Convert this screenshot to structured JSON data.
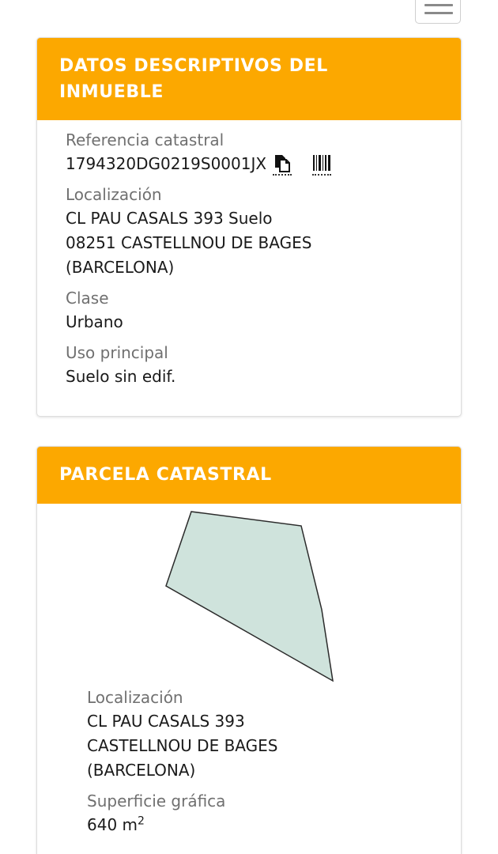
{
  "menu": {
    "icon": "hamburger-menu-icon"
  },
  "inmueble": {
    "title": "DATOS DESCRIPTIVOS DEL INMUEBLE",
    "ref_label": "Referencia catastral",
    "ref_value": "1794320DG0219S0001JX",
    "copy_icon": "copy-icon",
    "barcode_icon": "barcode-icon",
    "loc_label": "Localización",
    "loc_line1": "CL PAU CASALS 393 Suelo",
    "loc_line2": "08251 CASTELLNOU DE BAGES",
    "loc_line3": "(BARCELONA)",
    "clase_label": "Clase",
    "clase_value": "Urbano",
    "uso_label": "Uso principal",
    "uso_value": "Suelo sin edif."
  },
  "parcela": {
    "title": "PARCELA CATASTRAL",
    "shape_fill": "#cfe3dc",
    "shape_stroke": "#2b2b2b",
    "loc_label": "Localización",
    "loc_line1": "CL PAU CASALS 393",
    "loc_line2": "CASTELLNOU DE BAGES",
    "loc_line3": "(BARCELONA)",
    "sup_label": "Superficie gráfica",
    "sup_value": "640 m",
    "sup_unit_exp": "2"
  },
  "colors": {
    "header_bg": "#fca800",
    "header_text": "#ffffff",
    "label_text": "#707070"
  }
}
